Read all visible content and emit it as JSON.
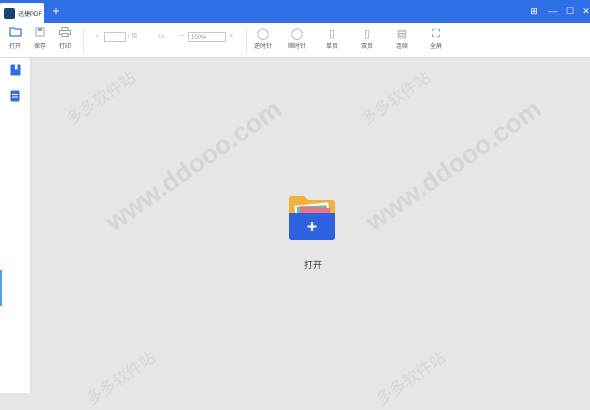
{
  "app": {
    "tab_title": "迅捷PDF",
    "new_tab": "+"
  },
  "window": {
    "grid": "⊞",
    "minimize": "—",
    "maximize": "☐",
    "close": "✕"
  },
  "toolbar": {
    "open": "打开",
    "save": "保存",
    "print": "打印",
    "page_value": "",
    "page_suffix": "/ 页",
    "zoom_value": "100%",
    "rotate_ccw": "逆时针",
    "rotate_cw": "顺时针",
    "single": "单页",
    "double": "双页",
    "continuous": "连续",
    "fullscreen": "全屏"
  },
  "main": {
    "open_label": "打开"
  },
  "watermark": {
    "text_cn": "多多软件站",
    "text_url": "www.ddooo.com"
  },
  "colors": {
    "accent": "#2f6fe6",
    "folder_front": "#2f62e0",
    "folder_back": "#f2b23a"
  }
}
